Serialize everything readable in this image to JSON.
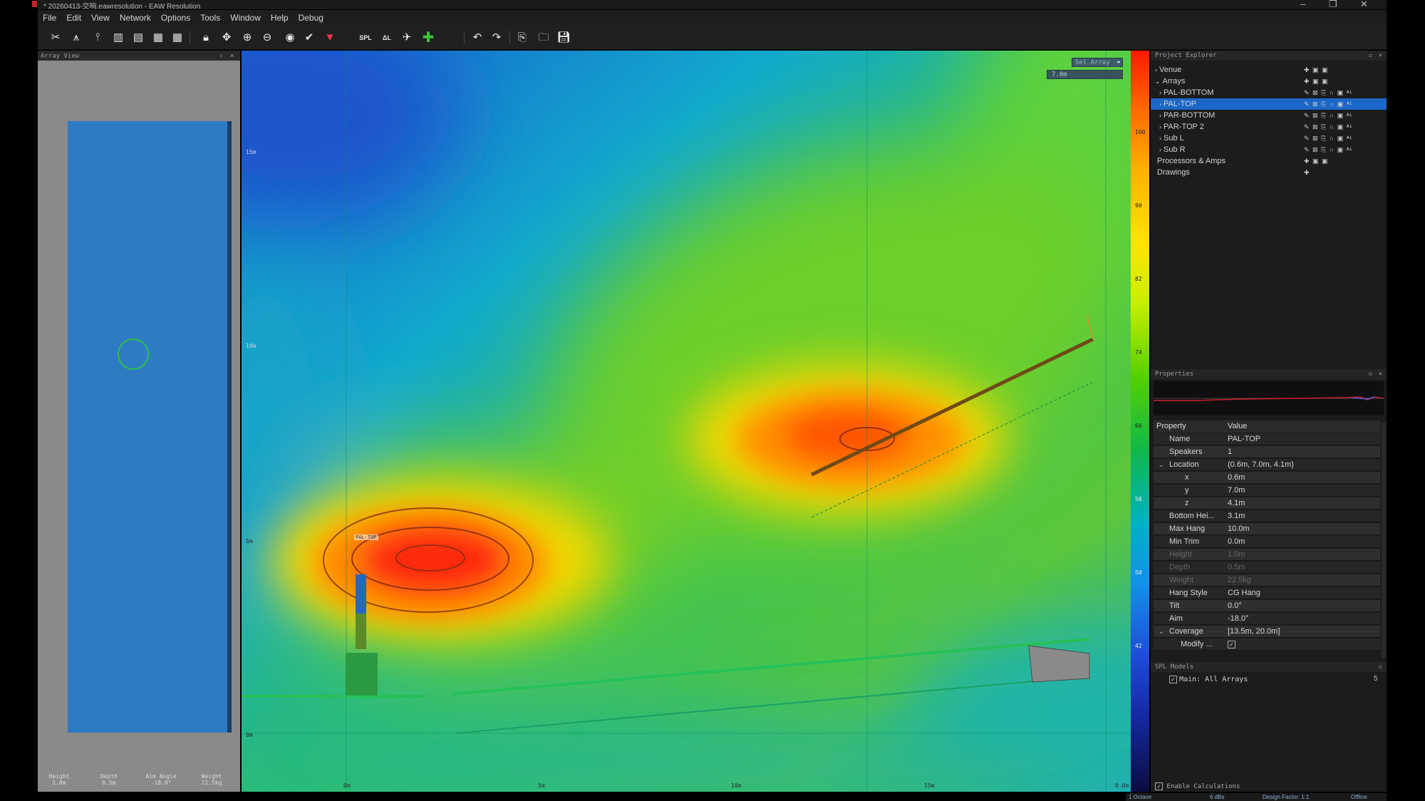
{
  "window": {
    "title": "* 20260413-交响.eawresolution - EAW Resolution",
    "minimize": "–",
    "maximize": "❐",
    "close": "✕"
  },
  "menu": [
    "File",
    "Edit",
    "View",
    "Network",
    "Options",
    "Tools",
    "Window",
    "Help",
    "Debug"
  ],
  "toolbar": [
    "tool-icon",
    "array-icon",
    "speaker-icon",
    "bars-icon",
    "bars-icon",
    "bars-icon",
    "bars-icon",
    "bars-icon",
    "lock-icon",
    "move-icon",
    "zoom-in-icon",
    "zoom-out-icon",
    "eye-icon",
    "check-icon",
    "mic-icon",
    "spl-icon",
    "spl-icon",
    "add-icon",
    "plus-icon",
    "undo-icon",
    "redo-icon",
    "import-icon",
    "open-icon",
    "save-icon"
  ],
  "array_view": {
    "title": "Array View",
    "footer": [
      {
        "label": "Height",
        "value": "1.0m"
      },
      {
        "label": "Depth",
        "value": "0.5m"
      },
      {
        "label": "Aim Angle",
        "value": "-18.0°"
      },
      {
        "label": "Weight",
        "value": "22.5kg"
      }
    ]
  },
  "spl_view": {
    "selected_array_label": "Sel Array",
    "selected_value": "7.0m",
    "array_label": "PAL-TOP",
    "y_labels": [
      "15m",
      "10m",
      "5m",
      "0m"
    ],
    "x_labels": [
      "0m",
      "5m",
      "10m",
      "15m",
      "0.0m"
    ]
  },
  "scale": {
    "ticks": [
      "100",
      "90",
      "82",
      "74",
      "66",
      "58",
      "50",
      "42"
    ]
  },
  "project_explorer": {
    "title": "Project Explorer",
    "items": [
      {
        "label": "Venue",
        "indent": 0,
        "expander": "›"
      },
      {
        "label": "Arrays",
        "indent": 0,
        "expander": "⌄"
      },
      {
        "label": "PAL-BOTTOM",
        "indent": 1,
        "expander": "›"
      },
      {
        "label": "PAL-TOP",
        "indent": 1,
        "expander": "›",
        "selected": true
      },
      {
        "label": "PAR-BOTTOM",
        "indent": 1,
        "expander": "›"
      },
      {
        "label": "PAR-TOP 2",
        "indent": 1,
        "expander": "›"
      },
      {
        "label": "Sub L",
        "indent": 1,
        "expander": "›"
      },
      {
        "label": "Sub R",
        "indent": 1,
        "expander": "›"
      },
      {
        "label": "Processors & Amps",
        "indent": 0,
        "expander": ""
      },
      {
        "label": "Drawings",
        "indent": 0,
        "expander": ""
      }
    ]
  },
  "properties": {
    "title": "Properties",
    "header_property": "Property",
    "header_value": "Value",
    "rows": [
      {
        "name": "Name",
        "value": "PAL-TOP"
      },
      {
        "name": "Speakers",
        "value": "1"
      },
      {
        "name": "Location",
        "value": "(0.6m, 7.0m, 4.1m)",
        "expander": "⌄"
      },
      {
        "name": "x",
        "value": "0.6m",
        "sub": true
      },
      {
        "name": "y",
        "value": "7.0m",
        "sub": true
      },
      {
        "name": "z",
        "value": "4.1m",
        "sub": true
      },
      {
        "name": "Bottom Hei...",
        "value": "3.1m"
      },
      {
        "name": "Max Hang",
        "value": "10.0m"
      },
      {
        "name": "Min Trim",
        "value": "0.0m"
      },
      {
        "name": "Height",
        "value": "1.0m",
        "dim": true
      },
      {
        "name": "Depth",
        "value": "0.5m",
        "dim": true
      },
      {
        "name": "Weight",
        "value": "22.5kg",
        "dim": true
      },
      {
        "name": "Hang Style",
        "value": "CG Hang"
      },
      {
        "name": "Tilt",
        "value": "0.0°"
      },
      {
        "name": "Aim",
        "value": "-18.0°"
      },
      {
        "name": "Coverage",
        "value": "[13.5m, 20.0m]",
        "expander": "⌄"
      },
      {
        "name": "Modify ...",
        "value": "✓",
        "sub": true
      }
    ]
  },
  "spl_models": {
    "title": "SPL Models",
    "item": "Main: All Arrays",
    "count": "5"
  },
  "enable_calc": "Enable Calculations",
  "status": [
    "1 Octave",
    "6 dBs",
    "Design Factor: 1:1",
    "Offline"
  ]
}
